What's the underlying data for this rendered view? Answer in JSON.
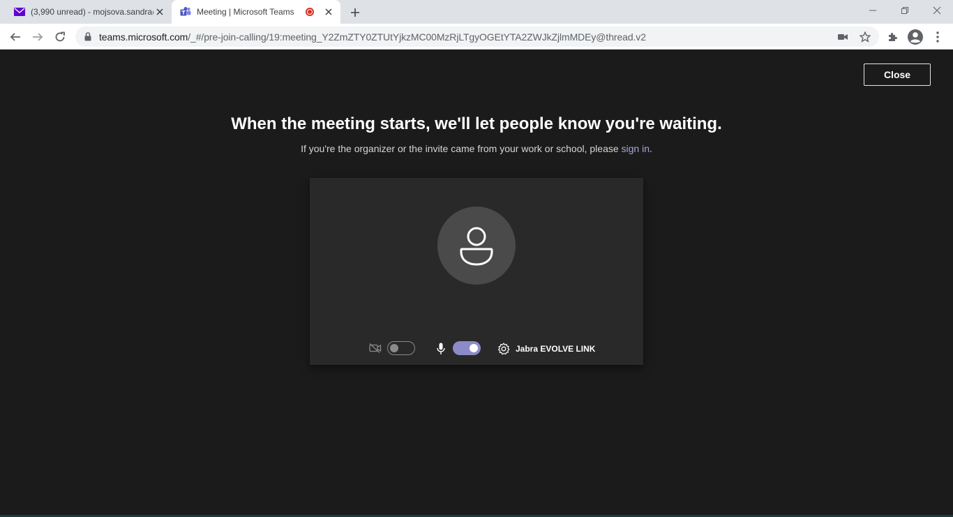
{
  "browser": {
    "tabs": [
      {
        "title": "(3,990 unread) - mojsova.sandra@",
        "icon": "yahoo-mail-icon",
        "active": false
      },
      {
        "title": "Meeting | Microsoft Teams",
        "icon": "teams-icon",
        "active": true,
        "recording": true
      }
    ],
    "address": {
      "host": "teams.microsoft.com",
      "path": "/_#/pre-join-calling/19:meeting_Y2ZmZTY0ZTUtYjkzMC00MzRjLTgyOGEtYTA2ZWJkZjlmMDEy@thread.v2"
    }
  },
  "page": {
    "close_label": "Close",
    "headline": "When the meeting starts, we'll let people know you're waiting.",
    "subline_prefix": "If you're the organizer or the invite came from your work or school, please ",
    "subline_link": "sign in",
    "subline_suffix": "."
  },
  "preview": {
    "camera_on": false,
    "mic_on": true,
    "device_name": "Jabra EVOLVE LINK"
  },
  "colors": {
    "background": "#1b1b1b",
    "accent": "#8b8cc7",
    "link": "#a6a7dc"
  }
}
